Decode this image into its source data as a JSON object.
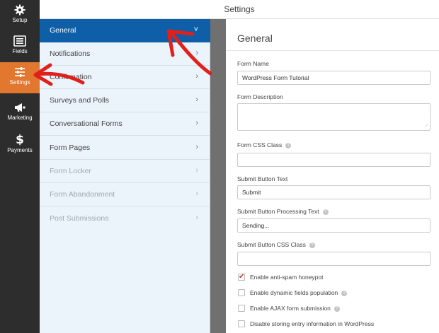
{
  "header": {
    "title": "Settings"
  },
  "iconbar": {
    "items": [
      {
        "label": "Setup",
        "icon": "gear-icon"
      },
      {
        "label": "Fields",
        "icon": "list-icon"
      },
      {
        "label": "Settings",
        "icon": "sliders-icon",
        "active": true
      },
      {
        "label": "Marketing",
        "icon": "megaphone-icon"
      },
      {
        "label": "Payments",
        "icon": "dollar-icon"
      }
    ],
    "active_color": "#e27730"
  },
  "submenu": {
    "items": [
      {
        "label": "General",
        "chevron": "˅",
        "active": true
      },
      {
        "label": "Notifications",
        "chevron": "›"
      },
      {
        "label": "Confirmation",
        "chevron": "›"
      },
      {
        "label": "Surveys and Polls",
        "chevron": "›"
      },
      {
        "label": "Conversational Forms",
        "chevron": "›"
      },
      {
        "label": "Form Pages",
        "chevron": "›"
      },
      {
        "label": "Form Locker",
        "chevron": "›",
        "disabled": true
      },
      {
        "label": "Form Abandonment",
        "chevron": "›",
        "disabled": true
      },
      {
        "label": "Post Submissions",
        "chevron": "›",
        "disabled": true
      }
    ],
    "active_color": "#0e5ea8"
  },
  "panel": {
    "title": "General",
    "form_name": {
      "label": "Form Name",
      "value": "WordPress Form Tutorial"
    },
    "form_description": {
      "label": "Form Description",
      "value": ""
    },
    "form_css_class": {
      "label": "Form CSS Class",
      "value": ""
    },
    "submit_text": {
      "label": "Submit Button Text",
      "value": "Submit"
    },
    "submit_processing": {
      "label": "Submit Button Processing Text",
      "value": "Sending..."
    },
    "submit_css_class": {
      "label": "Submit Button CSS Class",
      "value": ""
    },
    "help_glyph": "?",
    "checkboxes": [
      {
        "label": "Enable anti-spam honeypot",
        "checked": true,
        "help": false
      },
      {
        "label": "Enable dynamic fields population",
        "checked": false,
        "help": true
      },
      {
        "label": "Enable AJAX form submission",
        "checked": false,
        "help": true
      },
      {
        "label": "Disable storing entry information in WordPress",
        "checked": false,
        "help": false
      }
    ],
    "check_glyph": "✔"
  },
  "annotation_color": "#e0201b"
}
